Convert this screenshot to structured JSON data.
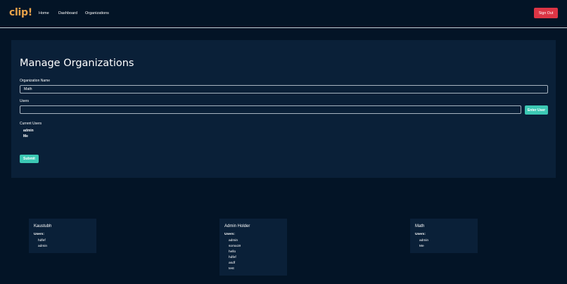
{
  "nav": {
    "logo": "clip!",
    "links": [
      "Home",
      "Dashboard",
      "Organizations"
    ],
    "signout_label": "Sign Out"
  },
  "manage": {
    "title": "Manage Organizations",
    "org_name_label": "Organization Name",
    "org_name_value": "Math",
    "users_label": "Users",
    "users_value": "",
    "enter_user_label": "Enter User",
    "current_users_label": "Current Users",
    "current_users": [
      "admin",
      "Me"
    ],
    "submit_label": "Submit"
  },
  "organizations": [
    {
      "name": "Kaustubh",
      "users_label": "Users:",
      "users": [
        "hdfef",
        "admin"
      ]
    },
    {
      "name": "Admin Holder",
      "users_label": "Users:",
      "users": [
        "admin",
        "soma19",
        "hello",
        "hdfef",
        "asdf",
        "test"
      ]
    },
    {
      "name": "Math",
      "users_label": "Users:",
      "users": [
        "admin",
        "Me"
      ]
    }
  ],
  "colors": {
    "background": "#031426",
    "card": "#0a2038",
    "accent": "#3cc8b4",
    "danger": "#dc3545",
    "logo": "#e8a24a"
  }
}
